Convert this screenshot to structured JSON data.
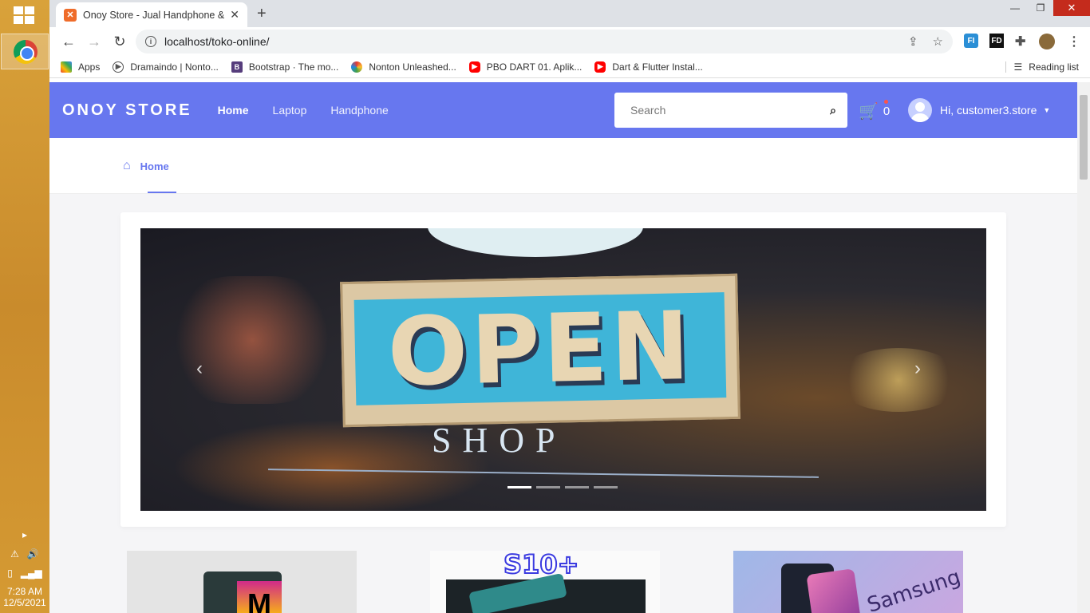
{
  "system": {
    "time": "7:28 AM",
    "date": "12/5/2021"
  },
  "browser": {
    "tab_title": "Onoy Store - Jual Handphone & L",
    "url": "localhost/toko-online/",
    "bookmarks": [
      {
        "label": "Apps",
        "icon": "apps-grid-icon"
      },
      {
        "label": "Dramaindo | Nonto...",
        "icon": "play-circle-icon"
      },
      {
        "label": "Bootstrap · The mo...",
        "icon": "bootstrap-icon"
      },
      {
        "label": "Nonton Unleashed...",
        "icon": "pinwheel-icon"
      },
      {
        "label": "PBO DART 01. Aplik...",
        "icon": "youtube-icon"
      },
      {
        "label": "Dart & Flutter Instal...",
        "icon": "youtube-icon"
      }
    ],
    "reading_list": "Reading list"
  },
  "site": {
    "brand": "ONOY STORE",
    "nav": [
      "Home",
      "Laptop",
      "Handphone"
    ],
    "search_placeholder": "Search",
    "cart_count": "0",
    "user_greeting": "Hi, customer3.store",
    "breadcrumb_home": "Home",
    "accent_color": "#6777ef"
  },
  "hero": {
    "sign_text": "OPEN",
    "sub_text": "SHOP",
    "slides_total": 4,
    "active_slide": 1
  },
  "products": [
    {
      "badge": "M"
    },
    {
      "badge": "S10+"
    },
    {
      "badge": "Samsung"
    }
  ]
}
